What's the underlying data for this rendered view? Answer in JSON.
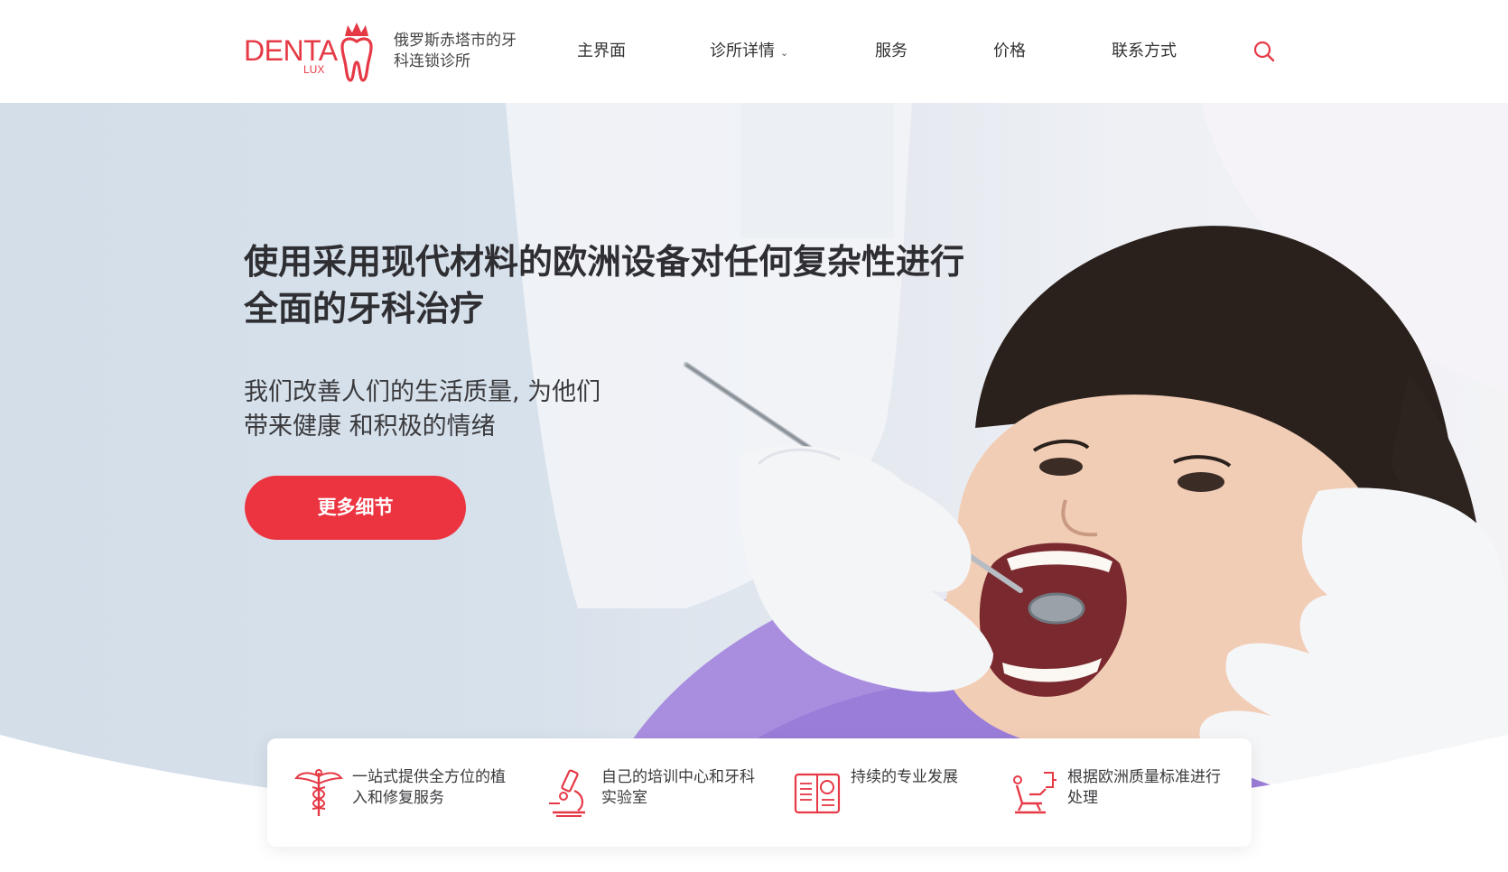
{
  "header": {
    "logo": {
      "word": "DENTA",
      "sub": "LUX"
    },
    "tagline": "俄罗斯赤塔市的牙科连锁诊所",
    "nav": [
      {
        "label": "主界面"
      },
      {
        "label": "诊所详情",
        "has_dropdown": true
      },
      {
        "label": "服务"
      },
      {
        "label": "价格"
      },
      {
        "label": "联系方式"
      }
    ],
    "search_icon": "search-icon"
  },
  "hero": {
    "title": "使用采用现代材料的欧洲设备对任何复杂性进行全面的牙科治疗",
    "subtitle": "我们改善人们的生活质量, 为他们带来健康 和积极的情绪",
    "cta_label": "更多细节"
  },
  "features": [
    {
      "icon": "caduceus-icon",
      "text": "一站式提供全方位的植入和修复服务"
    },
    {
      "icon": "microscope-icon",
      "text": "自己的培训中心和牙科实验室"
    },
    {
      "icon": "book-icon",
      "text": "持续的专业发展"
    },
    {
      "icon": "dental-chair-icon",
      "text": "根据欧洲质量标准进行处理"
    }
  ],
  "colors": {
    "accent": "#ec3440",
    "text": "#333333",
    "hero_bg": "#d7e1eb"
  }
}
